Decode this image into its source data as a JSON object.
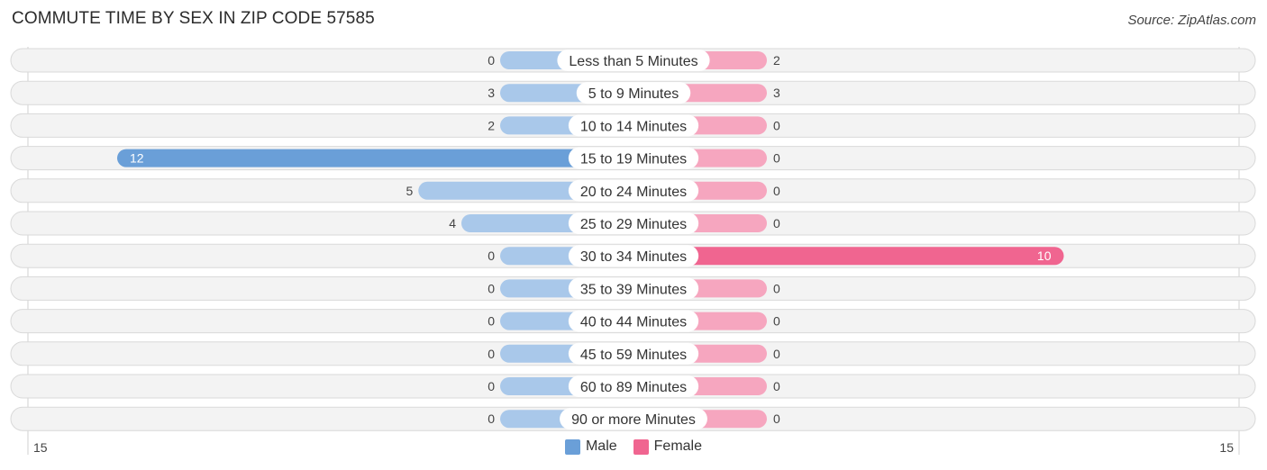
{
  "header": {
    "title": "COMMUTE TIME BY SEX IN ZIP CODE 57585",
    "source": "Source: ZipAtlas.com"
  },
  "colors": {
    "male": "#6a9fd8",
    "male_light": "#a9c8ea",
    "female": "#f06590",
    "female_light": "#f6a6bf"
  },
  "chart_data": {
    "type": "bar",
    "orientation": "horizontal-diverging",
    "title": "COMMUTE TIME BY SEX IN ZIP CODE 57585",
    "categories": [
      "Less than 5 Minutes",
      "5 to 9 Minutes",
      "10 to 14 Minutes",
      "15 to 19 Minutes",
      "20 to 24 Minutes",
      "25 to 29 Minutes",
      "30 to 34 Minutes",
      "35 to 39 Minutes",
      "40 to 44 Minutes",
      "45 to 59 Minutes",
      "60 to 89 Minutes",
      "90 or more Minutes"
    ],
    "series": [
      {
        "name": "Male",
        "values": [
          0,
          3,
          2,
          12,
          5,
          4,
          0,
          0,
          0,
          0,
          0,
          0
        ]
      },
      {
        "name": "Female",
        "values": [
          2,
          3,
          0,
          0,
          0,
          0,
          10,
          0,
          0,
          0,
          0,
          0
        ]
      }
    ],
    "axis": {
      "left_label": "15",
      "right_label": "15",
      "range": [
        -15,
        15
      ]
    },
    "legend": {
      "position": "bottom-center",
      "entries": [
        "Male",
        "Female"
      ]
    },
    "grid": false
  }
}
